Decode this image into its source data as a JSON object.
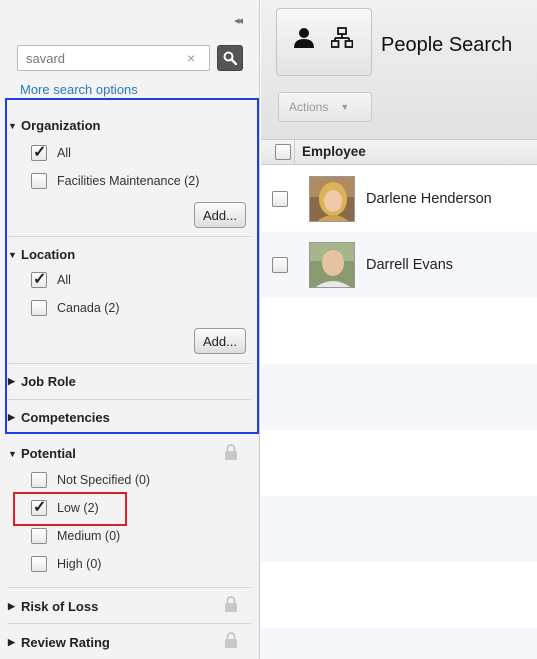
{
  "left": {
    "collapse_glyph": "◂◂",
    "search": {
      "value": "savard",
      "clear": "×"
    },
    "more_options": "More search options",
    "facets": [
      {
        "title": "Organization",
        "expanded": true,
        "locked": false,
        "options": [
          {
            "label": "All",
            "checked": true
          },
          {
            "label": "Facilities Maintenance (2)",
            "checked": false
          }
        ],
        "add_label": "Add..."
      },
      {
        "title": "Location",
        "expanded": true,
        "locked": false,
        "options": [
          {
            "label": "All",
            "checked": true
          },
          {
            "label": "Canada (2)",
            "checked": false
          }
        ],
        "add_label": "Add..."
      },
      {
        "title": "Job Role",
        "expanded": false,
        "locked": false
      },
      {
        "title": "Competencies",
        "expanded": false,
        "locked": false
      },
      {
        "title": "Potential",
        "expanded": true,
        "locked": true,
        "options": [
          {
            "label": "Not Specified (0)",
            "checked": false
          },
          {
            "label": "Low (2)",
            "checked": true
          },
          {
            "label": "Medium (0)",
            "checked": false
          },
          {
            "label": "High (0)",
            "checked": false
          }
        ]
      },
      {
        "title": "Risk of Loss",
        "expanded": false,
        "locked": true
      },
      {
        "title": "Review Rating",
        "expanded": false,
        "locked": true
      }
    ]
  },
  "right": {
    "page_title": "People Search",
    "actions_label": "Actions",
    "actions_caret": "▼",
    "table": {
      "header": "Employee",
      "rows": [
        {
          "name": "Darlene Henderson",
          "checked": false
        },
        {
          "name": "Darrell Evans",
          "checked": false
        }
      ]
    }
  },
  "icons": {
    "tri_down": "▼",
    "tri_right": "▶"
  },
  "colors": {
    "link": "#2a7bc2",
    "highlight_blue": "#1f3ee6",
    "highlight_red": "#e02020"
  }
}
